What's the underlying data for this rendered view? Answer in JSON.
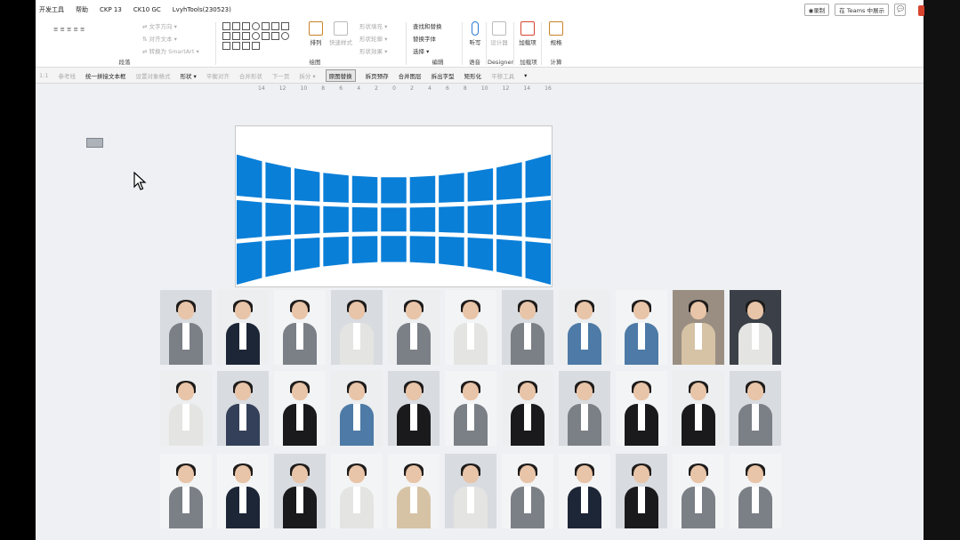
{
  "menu": [
    "开发工具",
    "帮助",
    "CKP 13",
    "CK10 GC",
    "LvyhTools(230523)"
  ],
  "topright": {
    "record": "◉录制",
    "teams": "在 Teams 中展示",
    "comment": "💬"
  },
  "ribbon": {
    "para_label": "段落",
    "para_rows": [
      "≡ ≡ ≡ ≡ ≡",
      "⇄ 文字方向 ▾",
      "⇅ 对齐文本 ▾",
      "⇄ 转换为 SmartArt ▾"
    ],
    "draw_label": "绘图",
    "arrange": "排列",
    "quick_style": "快速样式",
    "fill": "形状填充 ▾",
    "outline": "形状轮廓 ▾",
    "effect": "形状效果 ▾",
    "find": "查找和替换",
    "replace": "替换字体",
    "select": "选择 ▾",
    "edit_label": "编辑",
    "dictate": "听写",
    "voice_label": "语音",
    "designer": "设计器",
    "designer_label": "Designer",
    "addin": "加载项",
    "addin_label": "加载项",
    "rule": "规格",
    "rule_label": "计算"
  },
  "toolbar": {
    "items": [
      "1:1",
      "参考线",
      "统一拼接文本框",
      "设置对象格式",
      "形状 ▾",
      "平衡对齐",
      "合并形状",
      "下一页",
      "拆分 ▾",
      "原图替换",
      "拆页预存",
      "合并图层",
      "拆出字型",
      "矩形化",
      "平移工具"
    ],
    "active_index": 9,
    "on_indexes": [
      2,
      4,
      9,
      10,
      11,
      12,
      13
    ],
    "dropdown": "▾"
  },
  "ruler": [
    "14",
    "12",
    "10",
    "8",
    "6",
    "4",
    "2",
    "0",
    "2",
    "4",
    "6",
    "8",
    "10",
    "12",
    "14",
    "16"
  ],
  "slide": {
    "tile_color": "#0a7fd8",
    "grid": {
      "columns": 11,
      "rows": 3
    }
  },
  "photos": {
    "rows": [
      [
        "grey",
        "navy",
        "grey",
        "white",
        "grey",
        "white",
        "grey",
        "denim",
        "denim",
        "beige",
        "white"
      ],
      [
        "white",
        "stripe",
        "black",
        "denim",
        "black",
        "grey",
        "black",
        "grey",
        "black",
        "black",
        "grey"
      ],
      [
        "grey",
        "navy",
        "black",
        "white",
        "beige",
        "white",
        "grey",
        "navy",
        "black",
        "grey",
        "grey"
      ]
    ],
    "palette": {
      "grey": "#7b7f86",
      "navy": "#1d2637",
      "white": "#e4e4e2",
      "denim": "#4d7aa6",
      "beige": "#d6c3a5",
      "black": "#1a1a1c",
      "stripe": "#34405a"
    }
  }
}
